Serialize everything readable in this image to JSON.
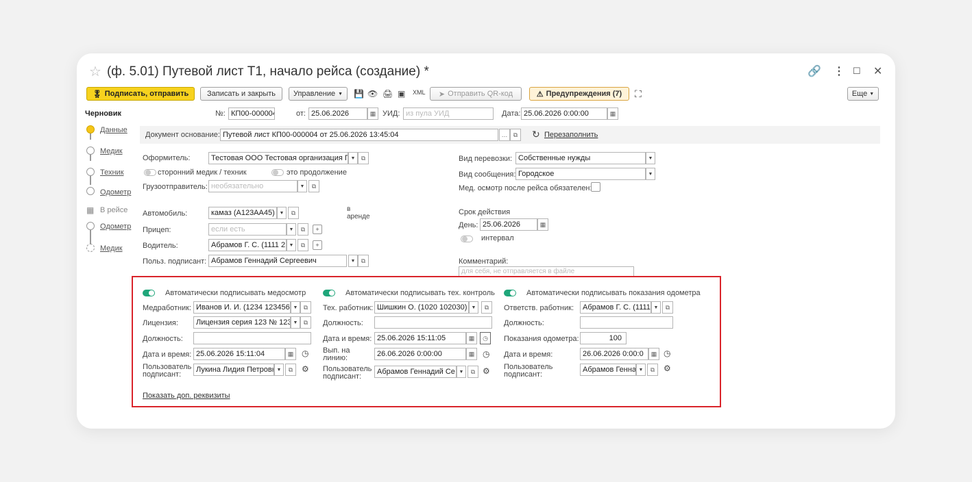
{
  "window": {
    "title": "(ф. 5.01) Путевой лист Т1, начало рейса (создание) *"
  },
  "toolbar": {
    "sign_send": "Подписать, отправить",
    "save_close": "Записать и закрыть",
    "management": "Управление",
    "qr": "Отправить QR-код",
    "warnings": "Предупреждения (7)",
    "more": "Еще"
  },
  "sidebar": {
    "status": "Черновик",
    "steps": [
      {
        "label": "Данные"
      },
      {
        "label": "Медик"
      },
      {
        "label": "Техник"
      },
      {
        "label": "Одометр"
      },
      {
        "label": "В рейсе"
      },
      {
        "label": "Одометр"
      },
      {
        "label": "Медик"
      }
    ]
  },
  "header": {
    "number_label": "№:",
    "number": "КП00-000004",
    "from_label": "от:",
    "from_date": "25.06.2026",
    "uid_label": "УИД:",
    "uid_placeholder": "из пула УИД",
    "date_label": "Дата:",
    "date": "25.06.2026  0:00:00"
  },
  "basis": {
    "label": "Документ основание:",
    "value": "Путевой лист КП00-000004 от 25.06.2026 13:45:04",
    "refill": "Перезаполнить"
  },
  "left": {
    "issuer_label": "Оформитель:",
    "issuer": "Тестовая ООО Тестовая организация Г",
    "third_party": "сторонний медик / техник",
    "continuation": "это продолжение",
    "shipper_label": "Грузоотправитель:",
    "shipper_placeholder": "необязательно",
    "car_label": "Автомобиль:",
    "car": "камаз (А123АА45)",
    "rent": "в аренде",
    "trailer_label": "Прицеп:",
    "trailer_placeholder": "если есть",
    "driver_label": "Водитель:",
    "driver": "Абрамов Г. С. (1111 2",
    "signer_label": "Польз. подписант:",
    "signer": "Абрамов Геннадий Сергеевич"
  },
  "right": {
    "transport_label": "Вид перевозки:",
    "transport": "Собственные нужды",
    "route_label": "Вид сообщения:",
    "route": "Городское",
    "medcheck_label": "Мед. осмотр после рейса обязателен:",
    "validity_label": "Срок действия",
    "day_label": "День:",
    "day": "25.06.2026",
    "interval": "интервал",
    "comment_label": "Комментарий:",
    "comment_placeholder": "для себя, не отправляется в файле"
  },
  "med": {
    "toggle_label": "Автоматически подписывать медосмотр",
    "worker_label": "Медработник:",
    "worker": "Иванов И. И. (1234 123456",
    "license_label": "Лицензия:",
    "license": "Лицензия серия 123 № 123",
    "position_label": "Должность:",
    "position": "",
    "datetime_label": "Дата и время:",
    "datetime": "25.06.2026 15:11:04",
    "user_label1": "Пользователь",
    "user_label2": "подписант:",
    "user": "Лукина Лидия Петровн"
  },
  "tech": {
    "toggle_label": "Автоматически подписывать тех. контроль",
    "worker_label": "Тех. работник:",
    "worker": "Шишкин О. (1020 102030)",
    "position_label": "Должность:",
    "position": "",
    "datetime_label": "Дата и время:",
    "datetime": "25.06.2026 15:11:05",
    "release_label1": "Вып. на",
    "release_label2": "линию:",
    "release": "26.06.2026  0:00:00",
    "user_label1": "Пользователь",
    "user_label2": "подписант:",
    "user": "Абрамов Геннадий Се"
  },
  "odo": {
    "toggle_label": "Автоматически подписывать показания одометра",
    "worker_label": "Ответств. работник:",
    "worker": "Абрамов Г. С. (1111",
    "position_label": "Должность:",
    "position": "",
    "reading_label": "Показания одометра:",
    "reading": "100",
    "datetime_label": "Дата и время:",
    "datetime": "26.06.2026  0:00:0",
    "user_label1": "Пользователь",
    "user_label2": "подписант:",
    "user": "Абрамов Генна"
  },
  "footer": {
    "show_more": "Показать доп. реквизиты"
  },
  "colors": {
    "accent_yellow": "#f7d21e",
    "toggle_green": "#1fa67a",
    "highlight_red": "#d9242b"
  }
}
